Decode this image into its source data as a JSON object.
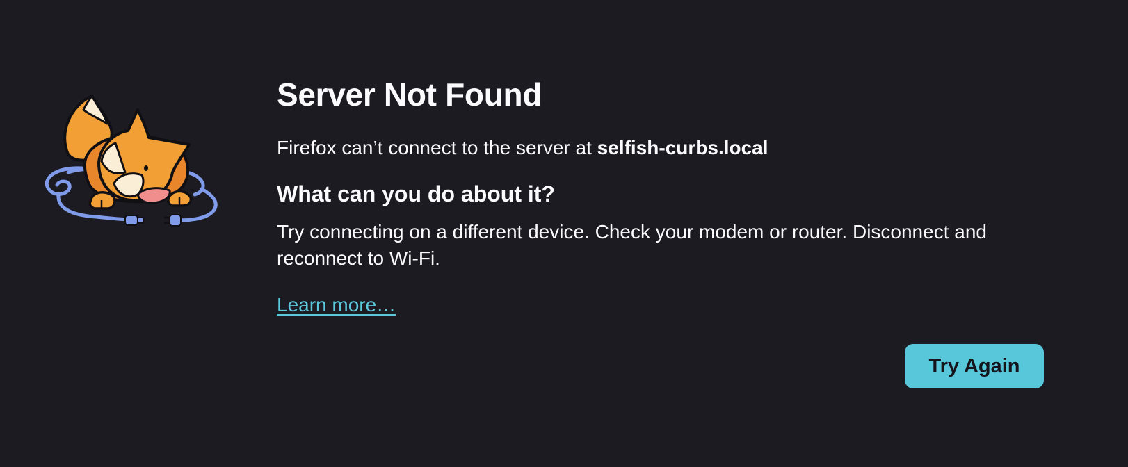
{
  "illustration": {
    "icon": "fox-unplugged-illustration",
    "colors": {
      "fox_orange": "#f2a036",
      "fox_dark_orange": "#e8862c",
      "cream": "#fbeed6",
      "cable": "#7f9bea",
      "nose": "#f08e8e"
    }
  },
  "error": {
    "title": "Server Not Found",
    "intro_text": "Firefox can’t connect to the server at ",
    "hostname": "selfish-curbs.local",
    "subheading": "What can you do about it?",
    "advice": "Try connecting on a different device. Check your modem or router. Disconnect and reconnect to Wi-Fi.",
    "learn_more_label": "Learn more…"
  },
  "actions": {
    "try_again_label": "Try Again"
  },
  "theme": {
    "background": "#1c1b22",
    "text": "#fbfbfe",
    "link": "#5bc8db",
    "button": "#58c7da",
    "button_text": "#15141a"
  }
}
